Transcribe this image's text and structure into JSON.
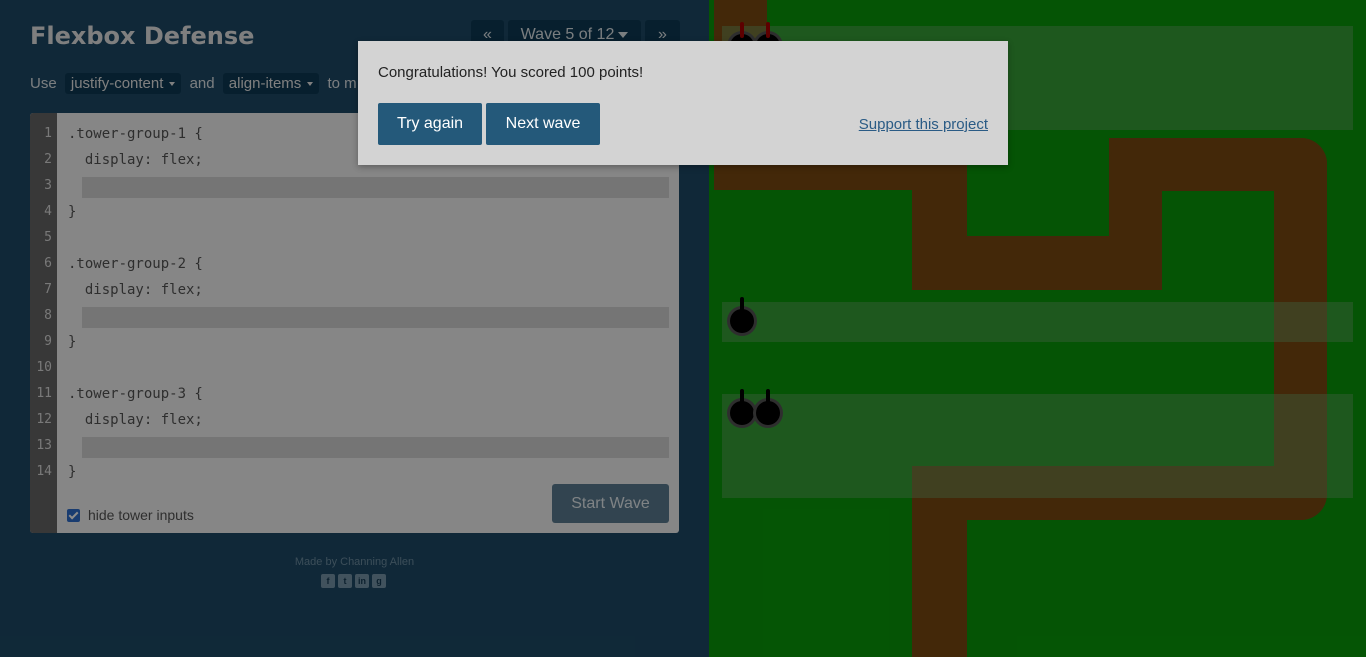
{
  "app": {
    "title": "Flexbox Defense"
  },
  "wave_nav": {
    "prev": "«",
    "current": "Wave 5 of 12",
    "next": "»"
  },
  "instructions": {
    "prefix": "Use",
    "prop1": "justify-content",
    "middle": "and",
    "prop2": "align-items",
    "suffix": "to m"
  },
  "editor": {
    "line_numbers": [
      "1",
      "2",
      "3",
      "4",
      "5",
      "6",
      "7",
      "8",
      "9",
      "10",
      "11",
      "12",
      "13",
      "14"
    ],
    "lines": [
      ".tower-group-1 {",
      "  display: flex;",
      "",
      "}",
      "",
      ".tower-group-2 {",
      "  display: flex;",
      "",
      "}",
      "",
      ".tower-group-3 {",
      "  display: flex;",
      "",
      "}"
    ],
    "hide_label": "hide tower inputs",
    "hide_checked": true,
    "start_label": "Start Wave"
  },
  "footer": {
    "made_by": "Made by Channing Allen",
    "social_icons": [
      "facebook-icon",
      "twitter-icon",
      "linkedin-icon",
      "github-icon"
    ]
  },
  "modal": {
    "message": "Congratulations! You scored 100 points!",
    "try_again": "Try again",
    "next_wave": "Next wave",
    "support": "Support this project"
  },
  "colors": {
    "accent": "#24597a",
    "board_green": "#0a9a0a",
    "path_brown": "#7a4a12"
  }
}
